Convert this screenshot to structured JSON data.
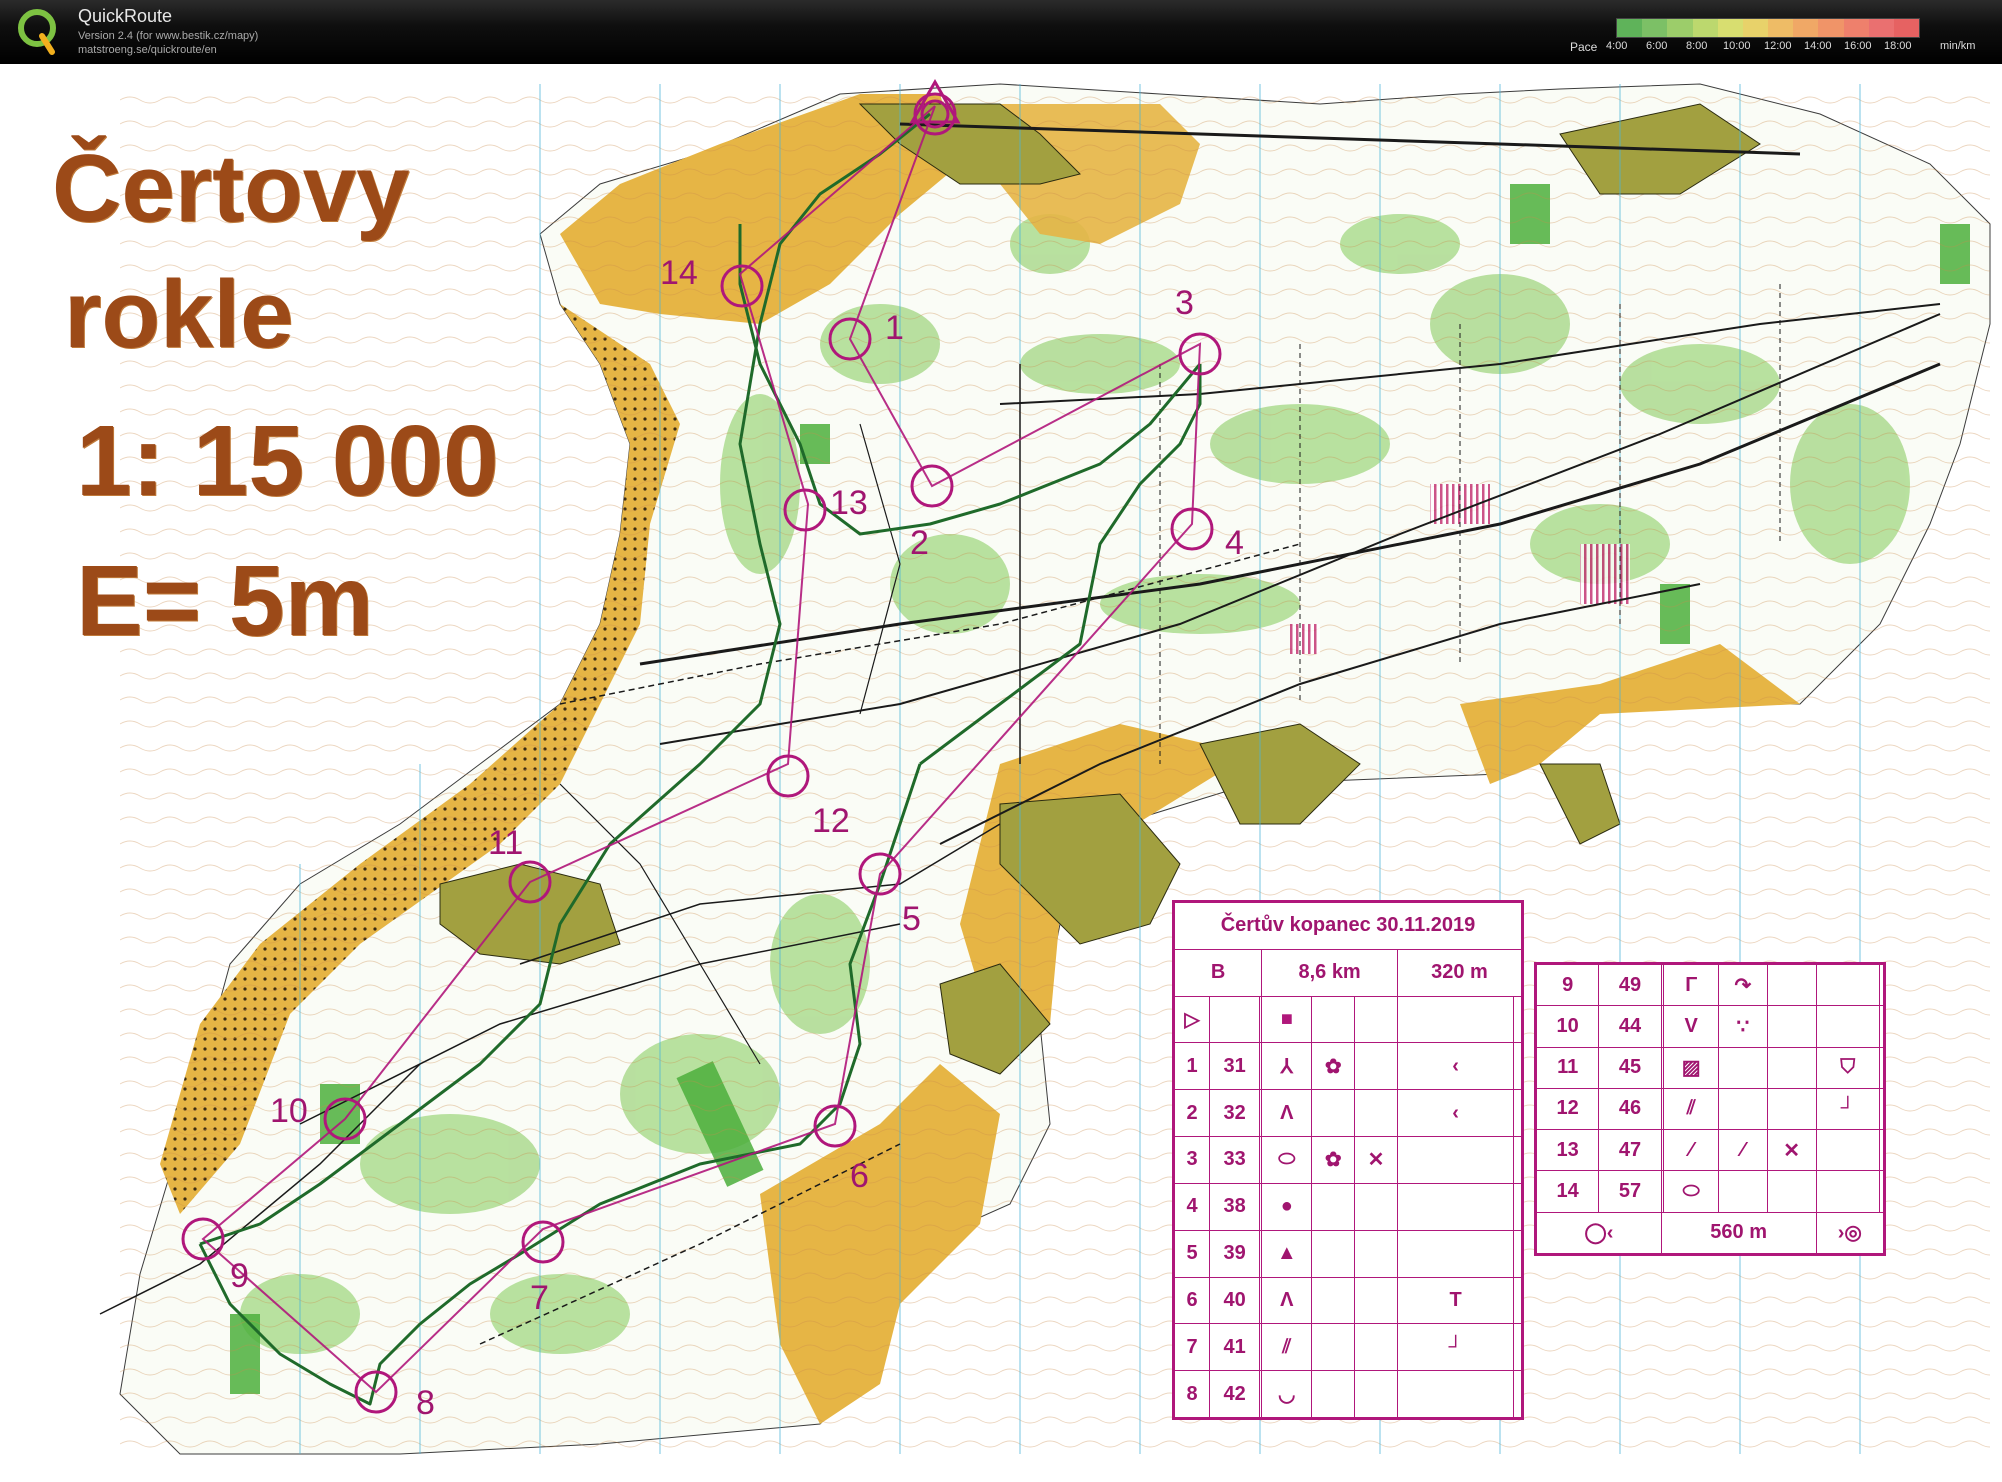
{
  "app": {
    "name": "QuickRoute",
    "version": "Version 2.4  (for www.bestik.cz/mapy)",
    "url": "matstroeng.se/quickroute/en"
  },
  "pace_legend": {
    "label": "Pace",
    "ticks": [
      "4:00",
      "6:00",
      "8:00",
      "10:00",
      "12:00",
      "14:00",
      "16:00",
      "18:00"
    ],
    "unit": "min/km",
    "colors": [
      "#5fb35a",
      "#7cc066",
      "#9ccd6a",
      "#bcd86e",
      "#d8de70",
      "#e8d26a",
      "#eebc66",
      "#f0a866",
      "#f09468",
      "#ee806c",
      "#ea7070",
      "#e66262"
    ]
  },
  "map": {
    "title_line1": "Čertovy",
    "title_line2": "rokle",
    "scale": "1: 15 000",
    "contour": "E= 5m",
    "course_color": "#b0177b",
    "controls": [
      {
        "label": "1"
      },
      {
        "label": "2"
      },
      {
        "label": "3"
      },
      {
        "label": "4"
      },
      {
        "label": "5"
      },
      {
        "label": "6"
      },
      {
        "label": "7"
      },
      {
        "label": "8"
      },
      {
        "label": "9"
      },
      {
        "label": "10"
      },
      {
        "label": "11"
      },
      {
        "label": "12"
      },
      {
        "label": "13"
      },
      {
        "label": "14"
      }
    ]
  },
  "control_description": {
    "event": "Čertův kopanec 30.11.2019",
    "course": "B",
    "length": "8,6 km",
    "climb": "320 m",
    "rows_left": [
      {
        "num": "1",
        "code": "31",
        "f1": "⅄",
        "f2": "✿",
        "f3": "",
        "f4": "‹"
      },
      {
        "num": "2",
        "code": "32",
        "f1": "Λ",
        "f2": "",
        "f3": "",
        "f4": "‹"
      },
      {
        "num": "3",
        "code": "33",
        "f1": "⬭",
        "f2": "✿",
        "f3": "✕",
        "f4": ""
      },
      {
        "num": "4",
        "code": "38",
        "f1": "●",
        "f2": "",
        "f3": "",
        "f4": ""
      },
      {
        "num": "5",
        "code": "39",
        "f1": "▲",
        "f2": "",
        "f3": "",
        "f4": ""
      },
      {
        "num": "6",
        "code": "40",
        "f1": "Λ",
        "f2": "",
        "f3": "",
        "f4": "T"
      },
      {
        "num": "7",
        "code": "41",
        "f1": "⫽",
        "f2": "",
        "f3": "",
        "f4": "┘"
      },
      {
        "num": "8",
        "code": "42",
        "f1": "◡",
        "f2": "",
        "f3": "",
        "f4": ""
      }
    ],
    "rows_right": [
      {
        "num": "9",
        "code": "49",
        "f1": "Γ",
        "f2": "↷",
        "f3": "",
        "f4": ""
      },
      {
        "num": "10",
        "code": "44",
        "f1": "V",
        "f2": "∵",
        "f3": "",
        "f4": ""
      },
      {
        "num": "11",
        "code": "45",
        "f1": "▨",
        "f2": "",
        "f3": "",
        "f4": "⛉"
      },
      {
        "num": "12",
        "code": "46",
        "f1": "⫽",
        "f2": "",
        "f3": "",
        "f4": "┘"
      },
      {
        "num": "13",
        "code": "47",
        "f1": "⁄",
        "f2": "⁄",
        "f3": "✕",
        "f4": ""
      },
      {
        "num": "14",
        "code": "57",
        "f1": "⬭",
        "f2": "",
        "f3": "",
        "f4": ""
      }
    ],
    "finish": "560 m"
  }
}
